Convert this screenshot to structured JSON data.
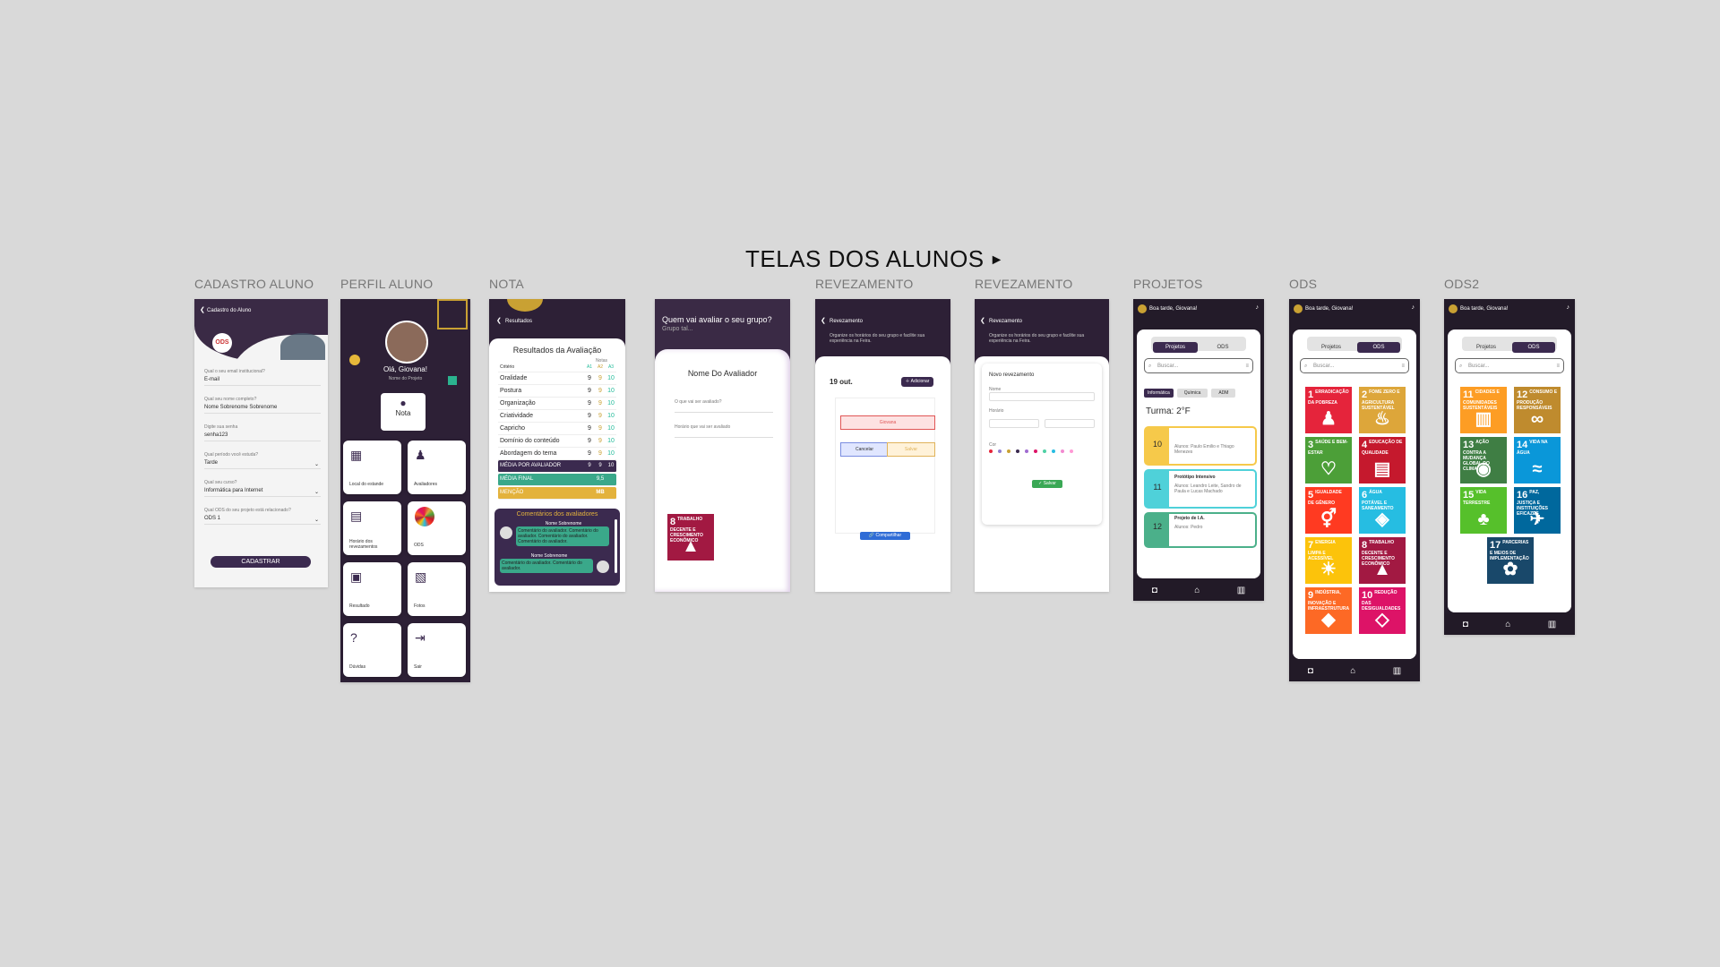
{
  "title": "TELAS DOS ALUNOS",
  "labels": {
    "cadastro": "CADASTRO ALUNO",
    "perfil": "PERFIL ALUNO",
    "nota": "NOTA",
    "rev1": "REVEZAMENTO",
    "rev2": "REVEZAMENTO",
    "projetos": "PROJETOS",
    "ods": "ODS",
    "ods2": "ODS2"
  },
  "cadastro": {
    "header": "Cadastro do Aluno",
    "fields": [
      {
        "label": "Qual o seu email institucional?",
        "value": "E-mail"
      },
      {
        "label": "Qual seu nome completo?",
        "value": "Nome Sobrenome Sobrenome"
      },
      {
        "label": "Digite sua senha",
        "value": "senha123"
      },
      {
        "label": "Qual período você estuda?",
        "value": "Tarde"
      },
      {
        "label": "Qual seu curso?",
        "value": "Informática para Internet"
      },
      {
        "label": "Qual ODS do seu projeto está relacionado?",
        "value": "ODS 1"
      }
    ],
    "submit": "CADASTRAR"
  },
  "perfil": {
    "greeting": "Olá, Giovana!",
    "project": "Nome do Projeto",
    "nota": "Nota",
    "tiles": [
      "Local do estande",
      "Avaliadores",
      "Horário dos revezamentos",
      "ODS",
      "Resultado",
      "Fotos",
      "Dúvidas",
      "Sair"
    ]
  },
  "nota": {
    "header": "Resultados",
    "card_title": "Resultados da Avaliação",
    "col_label": "Notas",
    "criterio": "Critério",
    "cols": [
      "A1",
      "A2",
      "A3"
    ],
    "rows": [
      {
        "name": "Oralidade",
        "a1": "9",
        "a2": "9",
        "a3": "10"
      },
      {
        "name": "Postura",
        "a1": "9",
        "a2": "9",
        "a3": "10"
      },
      {
        "name": "Organização",
        "a1": "9",
        "a2": "9",
        "a3": "10"
      },
      {
        "name": "Criatividade",
        "a1": "9",
        "a2": "9",
        "a3": "10"
      },
      {
        "name": "Capricho",
        "a1": "9",
        "a2": "9",
        "a3": "10"
      },
      {
        "name": "Domínio do conteúdo",
        "a1": "9",
        "a2": "9",
        "a3": "10"
      },
      {
        "name": "Abordagem do tema",
        "a1": "9",
        "a2": "9",
        "a3": "10"
      }
    ],
    "media_avaliador": {
      "label": "MÉDIA POR AVALIADOR",
      "a1": "9",
      "a2": "9",
      "a3": "10"
    },
    "media_final": {
      "label": "MÉDIA FINAL",
      "value": "9,5"
    },
    "mencao": {
      "label": "MENÇÃO",
      "value": "MB"
    },
    "comments_title": "Comentários dos avaliadores",
    "comments": [
      {
        "name": "Nome Sobrenome",
        "text": "Comentário do avaliador. Comentário do avaliador. Comentário do avaliador. Comentário do avaliador."
      },
      {
        "name": "Nome Sobrenome",
        "text": "Comentário do avaliador. Comentário do avaliador."
      }
    ]
  },
  "avaliador": {
    "question": "Quem vai avaliar o seu grupo?",
    "subtitle": "Grupo tal...",
    "name": "Nome Do Avaliador",
    "q1": "O que vai ser avaliado?",
    "q2": "Horário que vai ser avaliado",
    "sdg_num": "8",
    "sdg_text": "TRABALHO DECENTE E CRESCIMENTO ECONÔMICO"
  },
  "rev1": {
    "header": "Revezamento",
    "sub": "Organize os horários do seu grupo e facilite sua experiência na Feira.",
    "date": "19 out.",
    "add": "Adicionar",
    "slot": "Giovana",
    "cancel": "Cancelar",
    "save": "Salvar",
    "share": "Compartilhar"
  },
  "rev2": {
    "header": "Revezamento",
    "sub": "Organize os horários do seu grupo e facilite sua experiência na Feira.",
    "form_title": "Novo revezamento",
    "name_label": "Nome",
    "time_label": "Horário",
    "color_label": "Cor",
    "save": "Salvar"
  },
  "projetos": {
    "greeting": "Boa tarde, Giovana!",
    "tab1": "Projetos",
    "tab2": "ODS",
    "search": "Buscar...",
    "chips": [
      "Informática",
      "Química",
      "ADM"
    ],
    "turma": "Turma: 2°F",
    "cards": [
      {
        "num": "10",
        "title": "",
        "members": "Alunos: Paulo Emilio e Thiago Menezes"
      },
      {
        "num": "11",
        "title": "Protótipo Intensivo",
        "members": "Alunos: Leandro Leite, Sandro de Paula e Lucas Machado"
      },
      {
        "num": "12",
        "title": "Projeto de I.A.",
        "members": "Alunos: Pedro"
      }
    ]
  },
  "ods": {
    "greeting": "Boa tarde, Giovana!",
    "tab1": "Projetos",
    "tab2": "ODS",
    "search": "Buscar...",
    "goals": [
      {
        "n": "1",
        "t": "ERRADICAÇÃO DA POBREZA",
        "c": "#e5243b",
        "i": "♟"
      },
      {
        "n": "2",
        "t": "FOME ZERO E AGRICULTURA SUSTENTÁVEL",
        "c": "#dda63a",
        "i": "♨"
      },
      {
        "n": "3",
        "t": "SAÚDE E BEM-ESTAR",
        "c": "#4c9f38",
        "i": "♡"
      },
      {
        "n": "4",
        "t": "EDUCAÇÃO DE QUALIDADE",
        "c": "#c5192d",
        "i": "▤"
      },
      {
        "n": "5",
        "t": "IGUALDADE DE GÊNERO",
        "c": "#ff3a21",
        "i": "⚥"
      },
      {
        "n": "6",
        "t": "ÁGUA POTÁVEL E SANEAMENTO",
        "c": "#26bde2",
        "i": "◈"
      },
      {
        "n": "7",
        "t": "ENERGIA LIMPA E ACESSÍVEL",
        "c": "#fcc30b",
        "i": "☀"
      },
      {
        "n": "8",
        "t": "TRABALHO DECENTE E CRESCIMENTO ECONÔMICO",
        "c": "#a21942",
        "i": "▲"
      },
      {
        "n": "9",
        "t": "INDÚSTRIA, INOVAÇÃO E INFRAESTRUTURA",
        "c": "#fd6925",
        "i": "◆"
      },
      {
        "n": "10",
        "t": "REDUÇÃO DAS DESIGUALDADES",
        "c": "#dd1367",
        "i": "◇"
      }
    ]
  },
  "ods2": {
    "greeting": "Boa tarde, Giovana!",
    "tab1": "Projetos",
    "tab2": "ODS",
    "search": "Buscar...",
    "goals": [
      {
        "n": "11",
        "t": "CIDADES E COMUNIDADES SUSTENTÁVEIS",
        "c": "#fd9d24",
        "i": "▥"
      },
      {
        "n": "12",
        "t": "CONSUMO E PRODUÇÃO RESPONSÁVEIS",
        "c": "#bf8b2e",
        "i": "∞"
      },
      {
        "n": "13",
        "t": "AÇÃO CONTRA A MUDANÇA GLOBAL DO CLIMA",
        "c": "#3f7e44",
        "i": "◉"
      },
      {
        "n": "14",
        "t": "VIDA NA ÁGUA",
        "c": "#0a97d9",
        "i": "≈"
      },
      {
        "n": "15",
        "t": "VIDA TERRESTRE",
        "c": "#56c02b",
        "i": "♣"
      },
      {
        "n": "16",
        "t": "PAZ, JUSTIÇA E INSTITUIÇÕES EFICAZES",
        "c": "#00689d",
        "i": "✈"
      },
      {
        "n": "17",
        "t": "PARCERIAS E MEIOS DE IMPLEMENTAÇÃO",
        "c": "#19486a",
        "i": "✿"
      }
    ]
  },
  "nav_icons": [
    "camera-icon",
    "home-icon",
    "book-icon"
  ]
}
